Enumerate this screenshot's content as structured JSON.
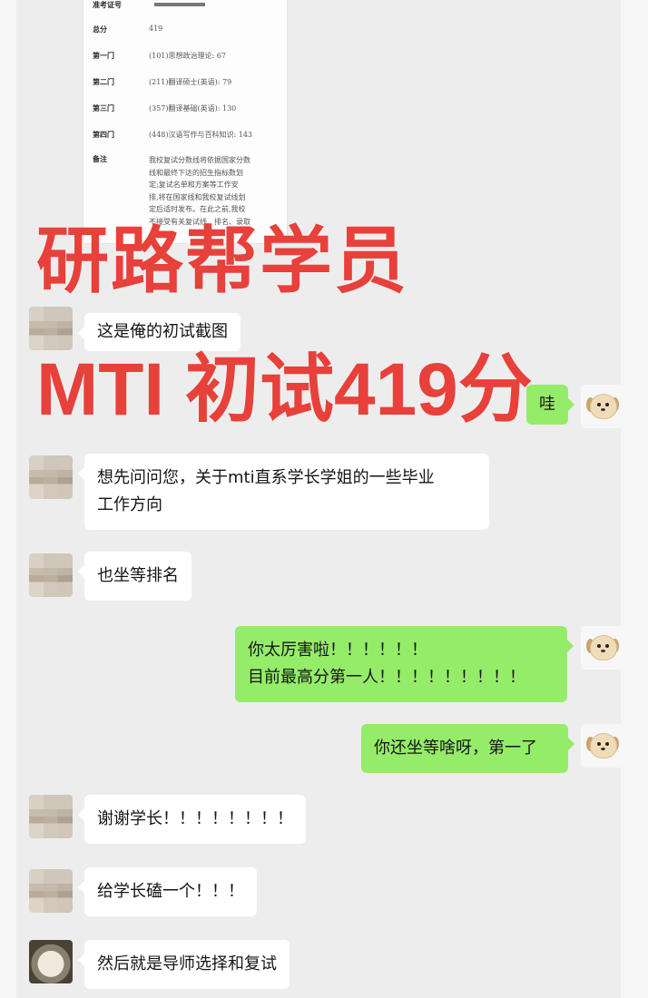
{
  "score_report": {
    "rows": [
      {
        "key": "准考证号",
        "value": ""
      },
      {
        "key": "总分",
        "value": "419"
      },
      {
        "key": "第一门",
        "value": "(101)思想政治理论: 67"
      },
      {
        "key": "第二门",
        "value": "(211)翻译硕士(英语): 79"
      },
      {
        "key": "第三门",
        "value": "(357)翻译基础(英语): 130"
      },
      {
        "key": "第四门",
        "value": "(448)汉语写作与百科知识: 143"
      },
      {
        "key": "备注",
        "value": "我校复试分数线将依据国家分数\n线和最终下达的招生指标数划\n定;复试名单和方案等工作安\n排,将在国家线和我校复试线划\n定后适时发布。在此之前,我校\n不接受有关复试线、排名、录取\n…"
      }
    ]
  },
  "overlay": {
    "line1": "研路帮学员",
    "line2": "MTI 初试419分"
  },
  "messages": [
    {
      "side": "in",
      "lines": [
        "这是俺的初试截图"
      ]
    },
    {
      "side": "out",
      "lines": [
        "哇"
      ]
    },
    {
      "side": "in",
      "lines": [
        "想先问问您，关于mti直系学长学姐的一些毕业",
        "工作方向"
      ]
    },
    {
      "side": "in",
      "lines": [
        "也坐等排名"
      ]
    },
    {
      "side": "out",
      "lines": [
        "你太厉害啦！！！！！！",
        "目前最高分第一人！！！！！！！！！"
      ]
    },
    {
      "side": "out",
      "lines": [
        "你还坐等啥呀，第一了"
      ]
    },
    {
      "side": "in",
      "lines": [
        "谢谢学长！！！！！！！！"
      ]
    },
    {
      "side": "in",
      "lines": [
        "给学长磕一个！！！"
      ]
    },
    {
      "side": "in",
      "lines": [
        "然后就是导师选择和复试"
      ]
    }
  ]
}
